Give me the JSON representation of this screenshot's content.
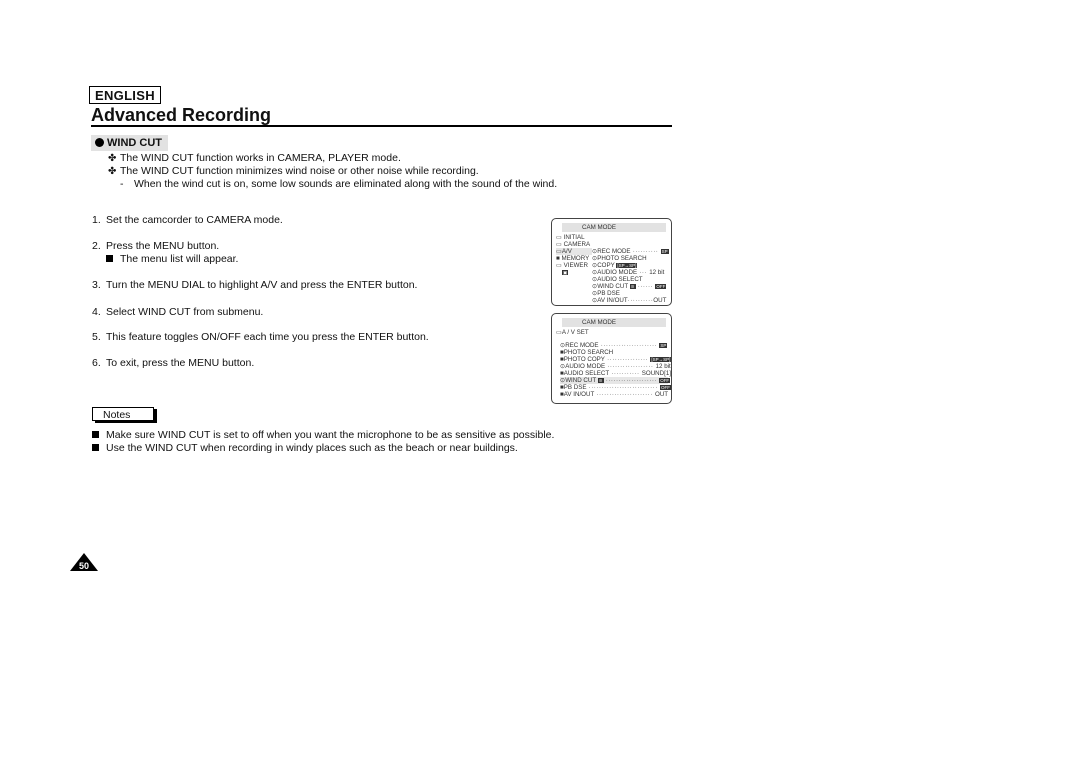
{
  "header": {
    "language": "ENGLISH",
    "title": "Advanced Recording"
  },
  "section": {
    "title": "WIND CUT",
    "intro": [
      "The WIND CUT function works in CAMERA, PLAYER mode.",
      "The WIND CUT function minimizes wind noise or other noise while recording."
    ],
    "intro_sub": "When the wind cut is on, some low sounds are eliminated along with the sound of the wind."
  },
  "steps": [
    {
      "num": "1.",
      "text": "Set the camcorder to CAMERA mode."
    },
    {
      "num": "2.",
      "text": "Press the MENU button.",
      "sub": "The menu list will appear."
    },
    {
      "num": "3.",
      "text": "Turn the MENU DIAL to highlight A/V and press the ENTER button."
    },
    {
      "num": "4.",
      "text": "Select WIND CUT from submenu."
    },
    {
      "num": "5.",
      "text": "This feature toggles ON/OFF each time you press the ENTER button."
    },
    {
      "num": "6.",
      "text": "To exit, press the MENU button."
    }
  ],
  "notes": {
    "label": "Notes",
    "items": [
      "Make sure WIND CUT is set to off when you want the microphone to be as sensitive as possible.",
      "Use the WIND CUT when recording in windy places such as the beach or near buildings."
    ]
  },
  "menu1": {
    "header": "CAM  MODE",
    "left_items": [
      "INITIAL",
      "CAMERA",
      "A/V",
      "MEMORY",
      "VIEWER"
    ],
    "right_items": [
      {
        "label": "REC MODE",
        "value": "SP"
      },
      {
        "label": "PHOTO SEARCH",
        "value": ""
      },
      {
        "label": "COPY",
        "value": "[SP→SP]"
      },
      {
        "label": "AUDIO MODE",
        "value": "12 bit"
      },
      {
        "label": "AUDIO SELECT",
        "value": ""
      },
      {
        "label": "WIND CUT",
        "value": "OFF"
      },
      {
        "label": "PB DSE",
        "value": ""
      },
      {
        "label": "AV IN/OUT",
        "value": "OUT"
      }
    ]
  },
  "menu2": {
    "header": "CAM  MODE",
    "submenu_title": "A / V SET",
    "items": [
      {
        "label": "REC MODE",
        "value": "SP"
      },
      {
        "label": "PHOTO SEARCH",
        "value": ""
      },
      {
        "label": "PHOTO COPY",
        "value": "[SP→SP]"
      },
      {
        "label": "AUDIO MODE",
        "value": "12 bit"
      },
      {
        "label": "AUDIO SELECT",
        "value": "SOUND[1]"
      },
      {
        "label": "WIND CUT",
        "value": "OFF"
      },
      {
        "label": "PB DSE",
        "value": "OFF"
      },
      {
        "label": "AV IN/OUT",
        "value": "OUT"
      }
    ]
  },
  "page_number": "50"
}
